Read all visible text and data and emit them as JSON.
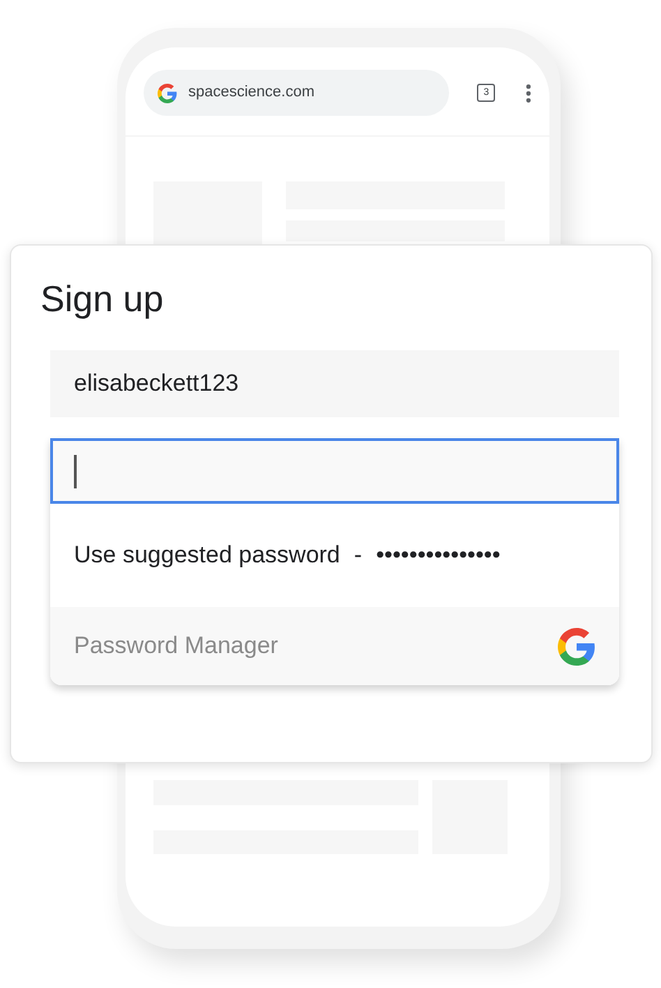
{
  "browser": {
    "url": "spacescience.com",
    "tab_count": "3"
  },
  "form": {
    "title": "Sign up",
    "username": {
      "value": "elisabeckett123"
    },
    "password": {
      "focused": true
    }
  },
  "suggestion": {
    "label": "Use suggested password",
    "separator": "-",
    "masked_password": "•••••••••••••••"
  },
  "footer": {
    "label": "Password Manager"
  }
}
